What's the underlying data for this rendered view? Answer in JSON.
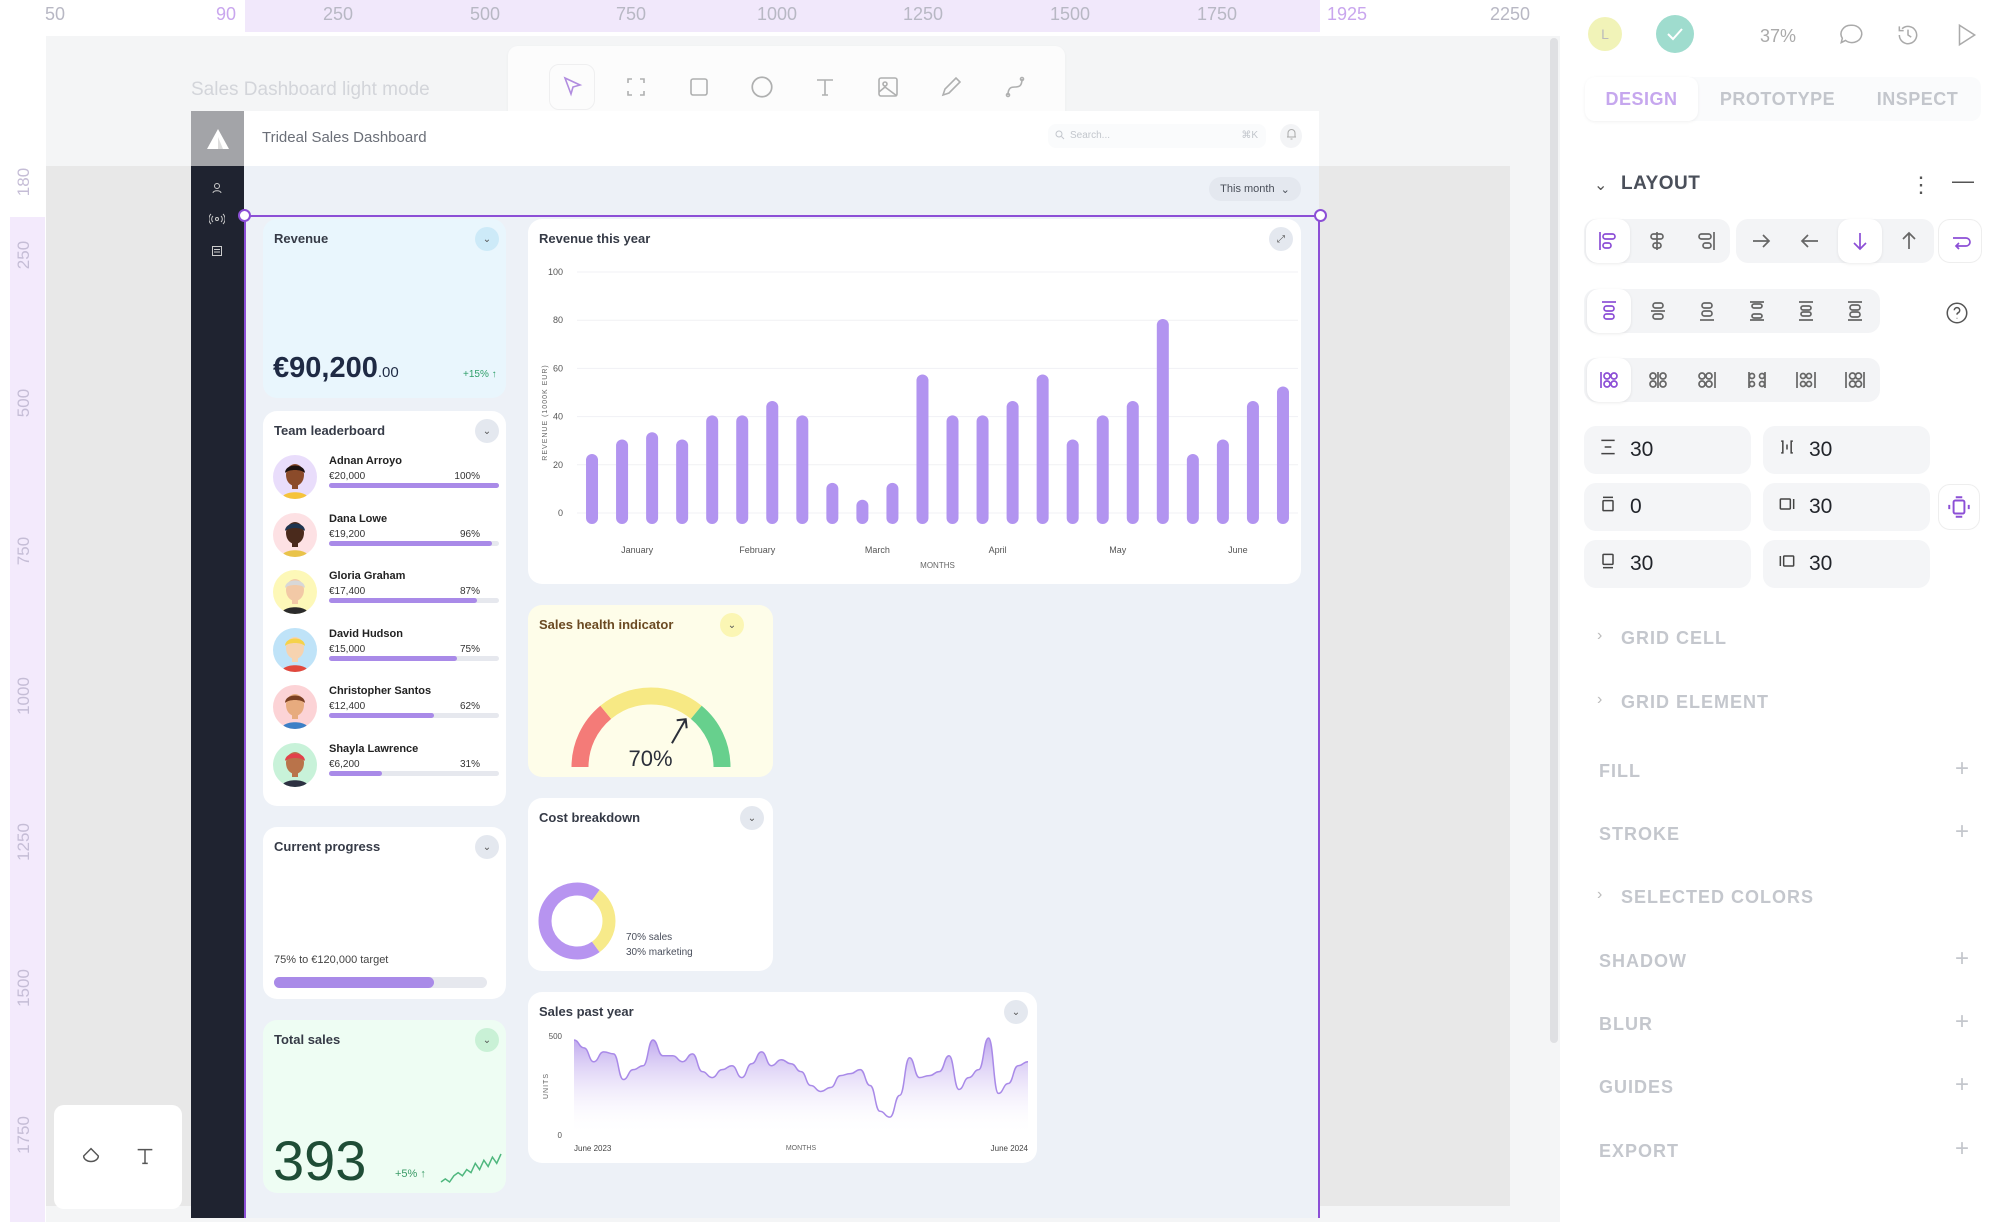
{
  "rulers": {
    "top": [
      "50",
      "90",
      "250",
      "500",
      "750",
      "1000",
      "1250",
      "1500",
      "1750",
      "1925",
      "2250"
    ],
    "left": [
      "180",
      "250",
      "500",
      "750",
      "1000",
      "1250",
      "1500",
      "1750"
    ]
  },
  "canvas": {
    "frame_label": "Sales Dashboard light mode"
  },
  "toolbar": {
    "tools": [
      "pointer-icon",
      "frame-icon",
      "rectangle-icon",
      "ellipse-icon",
      "text-icon",
      "image-icon",
      "pencil-icon",
      "path-icon"
    ],
    "active": "pointer-icon"
  },
  "bottom_tools": [
    "drop-icon",
    "text-icon"
  ],
  "dashboard": {
    "title": "Trideal Sales Dashboard",
    "search_placeholder": "Search...",
    "search_shortcut": "⌘K",
    "period": "This month",
    "revenue": {
      "title": "Revenue",
      "value": "€90,200",
      "cents": ".00",
      "change": "+15% ↑"
    },
    "leaderboard": {
      "title": "Team leaderboard",
      "rows": [
        {
          "name": "Adnan Arroyo",
          "amount": "€20,000",
          "pct": "100%",
          "value": 100,
          "bg": "#e9ddfb",
          "skin": "#8b4b2a",
          "hair": "#1d1210",
          "shirt": "#f5c33b"
        },
        {
          "name": "Dana Lowe",
          "amount": "€19,200",
          "pct": "96%",
          "value": 96,
          "bg": "#fde1e4",
          "skin": "#4a2a1c",
          "hair": "#1f3550",
          "shirt": "#e9c34a"
        },
        {
          "name": "Gloria Graham",
          "amount": "€17,400",
          "pct": "87%",
          "value": 87,
          "bg": "#fdf8b8",
          "skin": "#f2c9a6",
          "hair": "#d8d8d8",
          "shirt": "#2b2b2b"
        },
        {
          "name": "David Hudson",
          "amount": "€15,000",
          "pct": "75%",
          "value": 75,
          "bg": "#bfe3f8",
          "skin": "#f6d3b0",
          "hair": "#f5d24a",
          "shirt": "#e2483c"
        },
        {
          "name": "Christopher Santos",
          "amount": "€12,400",
          "pct": "62%",
          "value": 62,
          "bg": "#fcd3d6",
          "skin": "#e7ab7e",
          "hair": "#7a3f22",
          "shirt": "#3c7fc6"
        },
        {
          "name": "Shayla Lawrence",
          "amount": "€6,200",
          "pct": "31%",
          "value": 31,
          "bg": "#c8f2d9",
          "skin": "#b9734a",
          "hair": "#e2414b",
          "shirt": "#2d3142"
        }
      ]
    },
    "progress": {
      "title": "Current progress",
      "label": "75% to €120,000 target",
      "value": 75
    },
    "total_sales": {
      "title": "Total sales",
      "value": "393",
      "change": "+5% ↑",
      "sparkline": [
        2,
        3,
        2,
        4,
        5,
        4,
        6,
        5,
        8,
        6,
        9,
        7,
        10,
        8,
        11
      ]
    },
    "gauge": {
      "title": "Sales health indicator",
      "value": 70,
      "label": "70%",
      "colors": [
        "#f47b78",
        "#f7e984",
        "#67d08d"
      ]
    },
    "cost": {
      "title": "Cost breakdown",
      "slices": [
        {
          "label": "70% sales",
          "value": 70,
          "color": "#b794f0"
        },
        {
          "label": "30% marketing",
          "value": 30,
          "color": "#f7ea8a"
        }
      ]
    }
  },
  "chart_data": [
    {
      "type": "bar",
      "title": "Revenue this year",
      "xlabel": "MONTHS",
      "ylabel": "REVENUE (1000K EUR)",
      "ylim": [
        0,
        100
      ],
      "yticks": [
        "0",
        "20",
        "40",
        "60",
        "80",
        "100"
      ],
      "categories": [
        "January",
        "February",
        "March",
        "April",
        "May",
        "June"
      ],
      "values": [
        22,
        28,
        31,
        28,
        38,
        38,
        44,
        38,
        10,
        3,
        10,
        55,
        38,
        38,
        44,
        55,
        28,
        38,
        44,
        78,
        22,
        28,
        44,
        50
      ],
      "color": "#b294f0",
      "grid": true
    },
    {
      "type": "area",
      "title": "Sales past year",
      "xlabel": "MONTHS",
      "ylabel": "UNITS",
      "ylim": [
        0,
        500
      ],
      "yticks": [
        "0",
        "500"
      ],
      "x_labels": [
        "June 2023",
        "June 2024"
      ],
      "values": [
        480,
        440,
        370,
        420,
        410,
        280,
        330,
        350,
        480,
        400,
        400,
        370,
        410,
        320,
        290,
        330,
        350,
        290,
        360,
        420,
        350,
        380,
        360,
        320,
        250,
        220,
        240,
        300,
        310,
        330,
        250,
        120,
        90,
        200,
        390,
        290,
        300,
        320,
        400,
        230,
        290,
        330,
        490,
        210,
        260,
        350,
        370
      ],
      "color": "#a98ae8"
    }
  ],
  "panel": {
    "avatar_initial": "L",
    "zoom": "37%",
    "tabs": [
      "DESIGN",
      "PROTOTYPE",
      "INSPECT"
    ],
    "active_tab": "DESIGN",
    "layout_title": "LAYOUT",
    "direction_active": "arrow-down-icon",
    "fields": [
      {
        "icon": "row-gap-icon",
        "value": "30"
      },
      {
        "icon": "column-gap-icon",
        "value": "30"
      },
      {
        "icon": "padding-top-icon",
        "value": "0"
      },
      {
        "icon": "padding-right-icon",
        "value": "30"
      },
      {
        "icon": "padding-bottom-icon",
        "value": "30"
      },
      {
        "icon": "padding-left-icon",
        "value": "30"
      }
    ],
    "sections": [
      {
        "label": "GRID CELL",
        "chevron": true
      },
      {
        "label": "GRID ELEMENT",
        "chevron": true
      },
      {
        "label": "FILL",
        "plus": true
      },
      {
        "label": "STROKE",
        "plus": true
      },
      {
        "label": "SELECTED COLORS",
        "chevron": true
      },
      {
        "label": "SHADOW",
        "plus": true
      },
      {
        "label": "BLUR",
        "plus": true
      },
      {
        "label": "GUIDES",
        "plus": true
      },
      {
        "label": "EXPORT",
        "plus": true
      }
    ],
    "accent": "#8c4fd6"
  }
}
